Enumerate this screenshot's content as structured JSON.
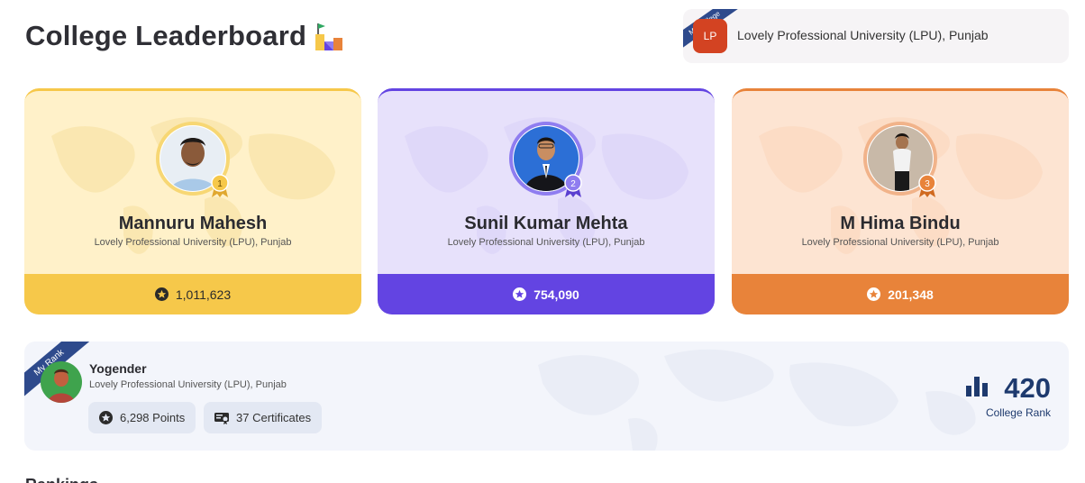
{
  "header": {
    "title": "College Leaderboard",
    "trophy_icon": "podium-flag-icon"
  },
  "my_college": {
    "ribbon": "My College",
    "badge": "LP",
    "name": "Lovely Professional University (LPU), Punjab"
  },
  "top3": [
    {
      "rank": "1",
      "name": "Mannuru Mahesh",
      "university": "Lovely Professional University (LPU), Punjab",
      "points": "1,011,623"
    },
    {
      "rank": "2",
      "name": "Sunil Kumar Mehta",
      "university": "Lovely Professional University (LPU), Punjab",
      "points": "754,090"
    },
    {
      "rank": "3",
      "name": "M Hima Bindu",
      "university": "Lovely Professional University (LPU), Punjab",
      "points": "201,348"
    }
  ],
  "my_rank": {
    "ribbon": "My Rank",
    "name": "Yogender",
    "university": "Lovely Professional University (LPU), Punjab",
    "points": "6,298 Points",
    "certificates": "37 Certificates",
    "rank": "420",
    "rank_label": "College Rank"
  },
  "section_next": {
    "title": "Rankings"
  },
  "colors": {
    "gold": "#f6c84a",
    "purple": "#6344e2",
    "orange": "#e8833a",
    "navy": "#1e3a6e"
  }
}
